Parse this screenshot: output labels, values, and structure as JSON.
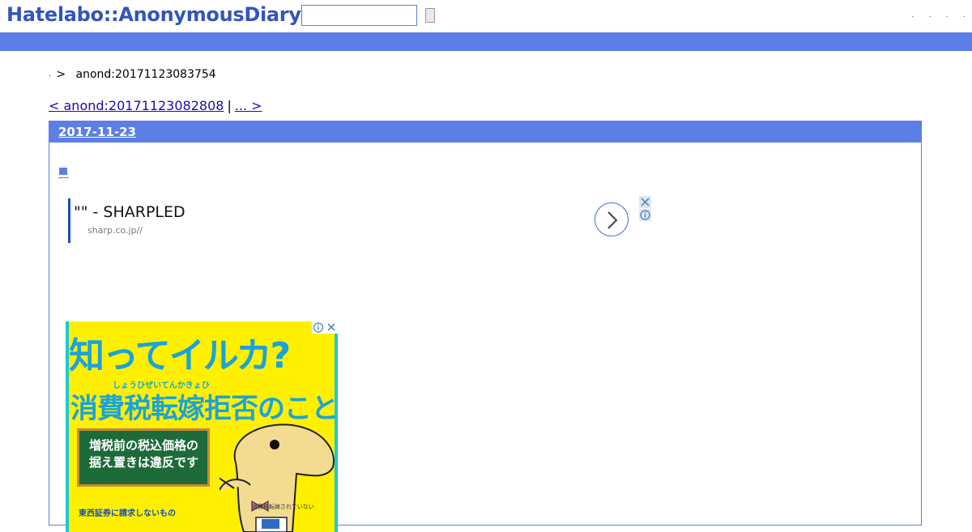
{
  "header": {
    "logo": "Hatelabo::AnonymousDiary",
    "search": {
      "value": "",
      "placeholder": ""
    },
    "links": [
      ".",
      ".",
      ".",
      "."
    ]
  },
  "breadcrumb": {
    "home": ".",
    "separator": ">",
    "current": "anond:20171123083754"
  },
  "pager": {
    "prev": "< anond:20171123082808",
    "divider": "|",
    "next": "... > "
  },
  "entry": {
    "date": "2017-11-23",
    "bullet": "■"
  },
  "ad": {
    "title": "\"\" - SHARPLED",
    "url": "sharp.co.jp//"
  },
  "banner": {
    "line1": "知ってイルカ?",
    "ruby": "しょうひぜいてんかきょひ",
    "line2": "消費税転嫁拒否のこと。",
    "board_line1": "増税前の税込価格の",
    "board_line2": "据え置きは違反です",
    "bottom_left": "東西証券に請求しないもの",
    "bottom_right": "消費税転嫁されていない"
  },
  "colors": {
    "accent": "#5b7fe6",
    "logo": "#3355bb",
    "link": "#1a0dab",
    "banner_yellow": "#fff000",
    "banner_blue": "#1aa3d9"
  }
}
